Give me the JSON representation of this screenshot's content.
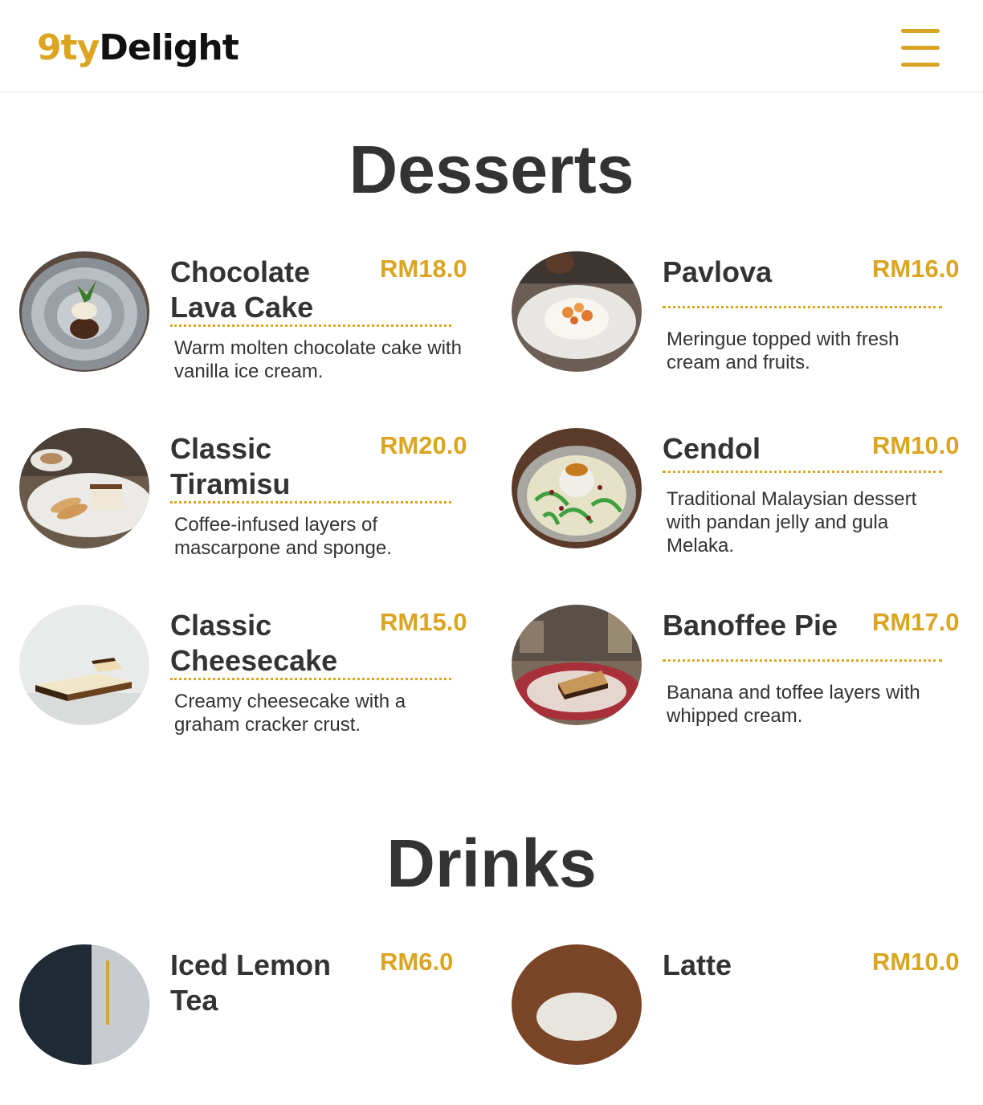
{
  "header": {
    "logo_accent": "9ty",
    "logo_main": "Delight",
    "menu_icon": "hamburger-menu-icon",
    "accent_color": "#dba521"
  },
  "sections": [
    {
      "title": "Desserts",
      "items": [
        {
          "name": "Chocolate Lava Cake",
          "price": "RM18.0",
          "desc": "Warm molten chocolate cake with vanilla ice cream."
        },
        {
          "name": "Pavlova",
          "price": "RM16.0",
          "desc": "Meringue topped with fresh cream and fruits."
        },
        {
          "name": "Classic Tiramisu",
          "price": "RM20.0",
          "desc": "Coffee-infused layers of mascarpone and sponge."
        },
        {
          "name": "Cendol",
          "price": "RM10.0",
          "desc": "Traditional Malaysian dessert with pandan jelly and gula Melaka."
        },
        {
          "name": "Classic Cheesecake",
          "price": "RM15.0",
          "desc": "Creamy cheesecake with a graham cracker crust."
        },
        {
          "name": "Banoffee Pie",
          "price": "RM17.0",
          "desc": "Banana and toffee layers with whipped cream."
        }
      ]
    },
    {
      "title": "Drinks",
      "items": [
        {
          "name": "Iced Lemon Tea",
          "price": "RM6.0",
          "desc": ""
        },
        {
          "name": "Latte",
          "price": "RM10.0",
          "desc": ""
        }
      ]
    }
  ]
}
